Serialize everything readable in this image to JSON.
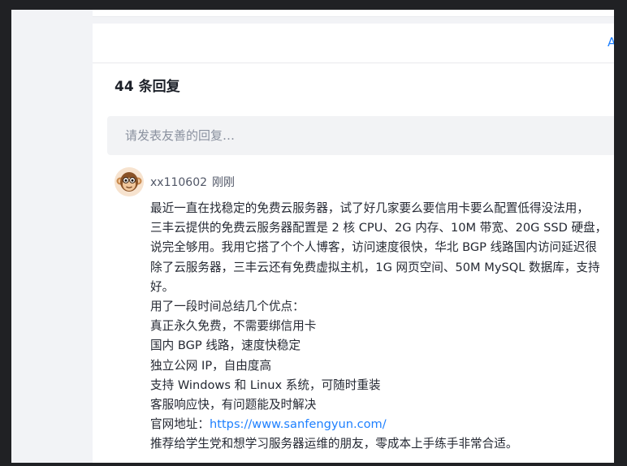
{
  "card_header": {
    "right_link": "A"
  },
  "comments": {
    "count_label": "44 条回复",
    "input_placeholder": "请发表友善的回复…",
    "items": [
      {
        "author": "xx110602",
        "time": "刚刚",
        "lines": [
          "最近一直在找稳定的免费云服务器，试了好几家要么要信用卡要么配置低得没法用，",
          "三丰云提供的免费云服务器配置是 2 核 CPU、2G 内存、10M 带宽、20G SSD 硬盘，",
          "说完全够用。我用它搭了个个人博客，访问速度很快，华北 BGP 线路国内访问延迟很",
          "除了云服务器，三丰云还有免费虚拟主机，1G 网页空间、50M MySQL 数据库，支持",
          "好。",
          "用了一段时间总结几个优点：",
          "真正永久免费，不需要绑信用卡",
          "国内 BGP 线路，速度快稳定",
          "独立公网 IP，自由度高",
          "支持 Windows 和 Linux 系统，可随时重装",
          "客服响应快，有问题能及时解决"
        ],
        "site_label": "官网地址：",
        "site_url": "https://www.sanfengyun.com/",
        "closing": "推荐给学生党和想学习服务器运维的朋友，零成本上手练手非常合适。"
      }
    ]
  }
}
